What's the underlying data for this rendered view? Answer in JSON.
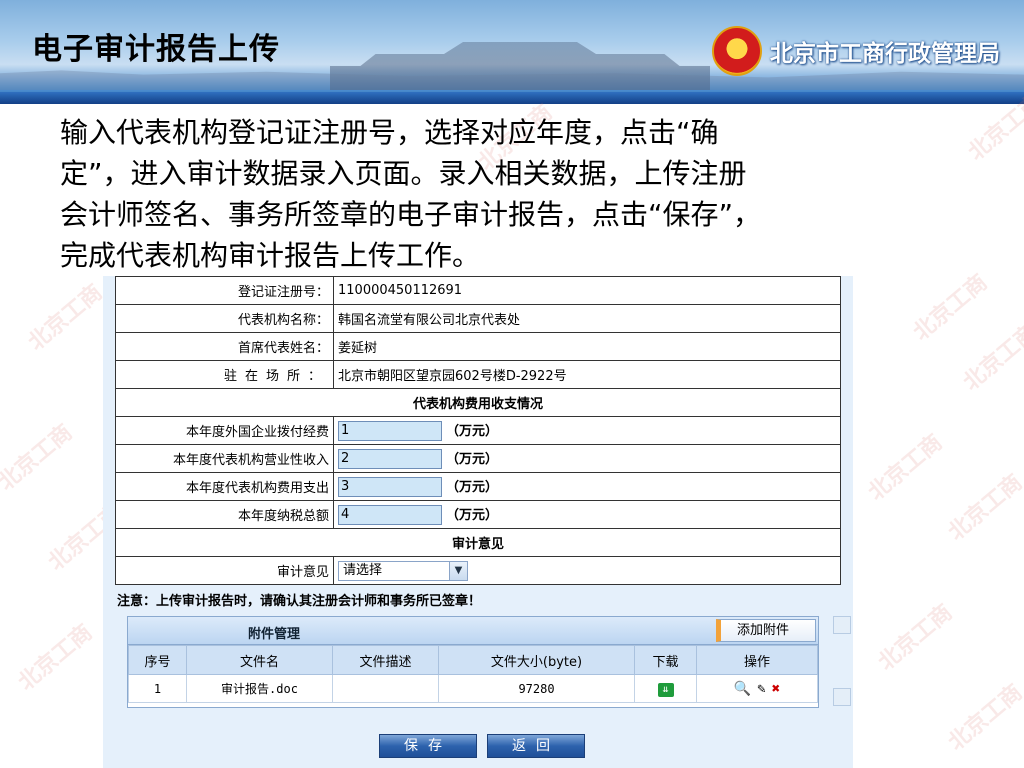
{
  "slide": {
    "title": "电子审计报告上传",
    "bureau": "北京市工商行政管理局",
    "watermark": "北京工商",
    "instruction_lines": [
      "输入代表机构登记证注册号，选择对应年度，点击“确",
      "定”，进入审计数据录入页面。录入相关数据，上传注册",
      "会计师签名、事务所签章的电子审计报告，点击“保存”，",
      "完成代表机构审计报告上传工作。"
    ]
  },
  "form": {
    "reg_no_label": "登记证注册号：",
    "reg_no_value": "110000450112691",
    "org_name_label": "代表机构名称：",
    "org_name_value": "韩国名流堂有限公司北京代表处",
    "rep_name_label": "首席代表姓名：",
    "rep_name_value": "姜延树",
    "address_label": "驻在场所：",
    "address_value": "北京市朝阳区望京园602号楼D-2922号",
    "finance_section": "代表机构费用收支情况",
    "finance_rows": [
      {
        "label": "本年度外国企业拨付经费",
        "value": "1",
        "unit": "（万元）"
      },
      {
        "label": "本年度代表机构营业性收入",
        "value": "2",
        "unit": "（万元）"
      },
      {
        "label": "本年度代表机构费用支出",
        "value": "3",
        "unit": "（万元）"
      },
      {
        "label": "本年度纳税总额",
        "value": "4",
        "unit": "（万元）"
      }
    ],
    "audit_section": "审计意见",
    "audit_label": "审计意见",
    "audit_select_value": "请选择",
    "notice": "注意：上传审计报告时，请确认其注册会计师和事务所已签章！"
  },
  "attachments": {
    "title": "附件管理",
    "add_button": "添加附件",
    "columns": [
      "序号",
      "文件名",
      "文件描述",
      "文件大小(byte)",
      "下载",
      "操作"
    ],
    "rows": [
      {
        "index": "1",
        "filename": "审计报告.doc",
        "description": "",
        "size": "97280"
      }
    ]
  },
  "buttons": {
    "save": "保存",
    "back": "返回"
  },
  "colors": {
    "banner_blue": "#1e5aa8",
    "input_fill": "#cfe6f7",
    "button_blue": "#2d62ad"
  }
}
